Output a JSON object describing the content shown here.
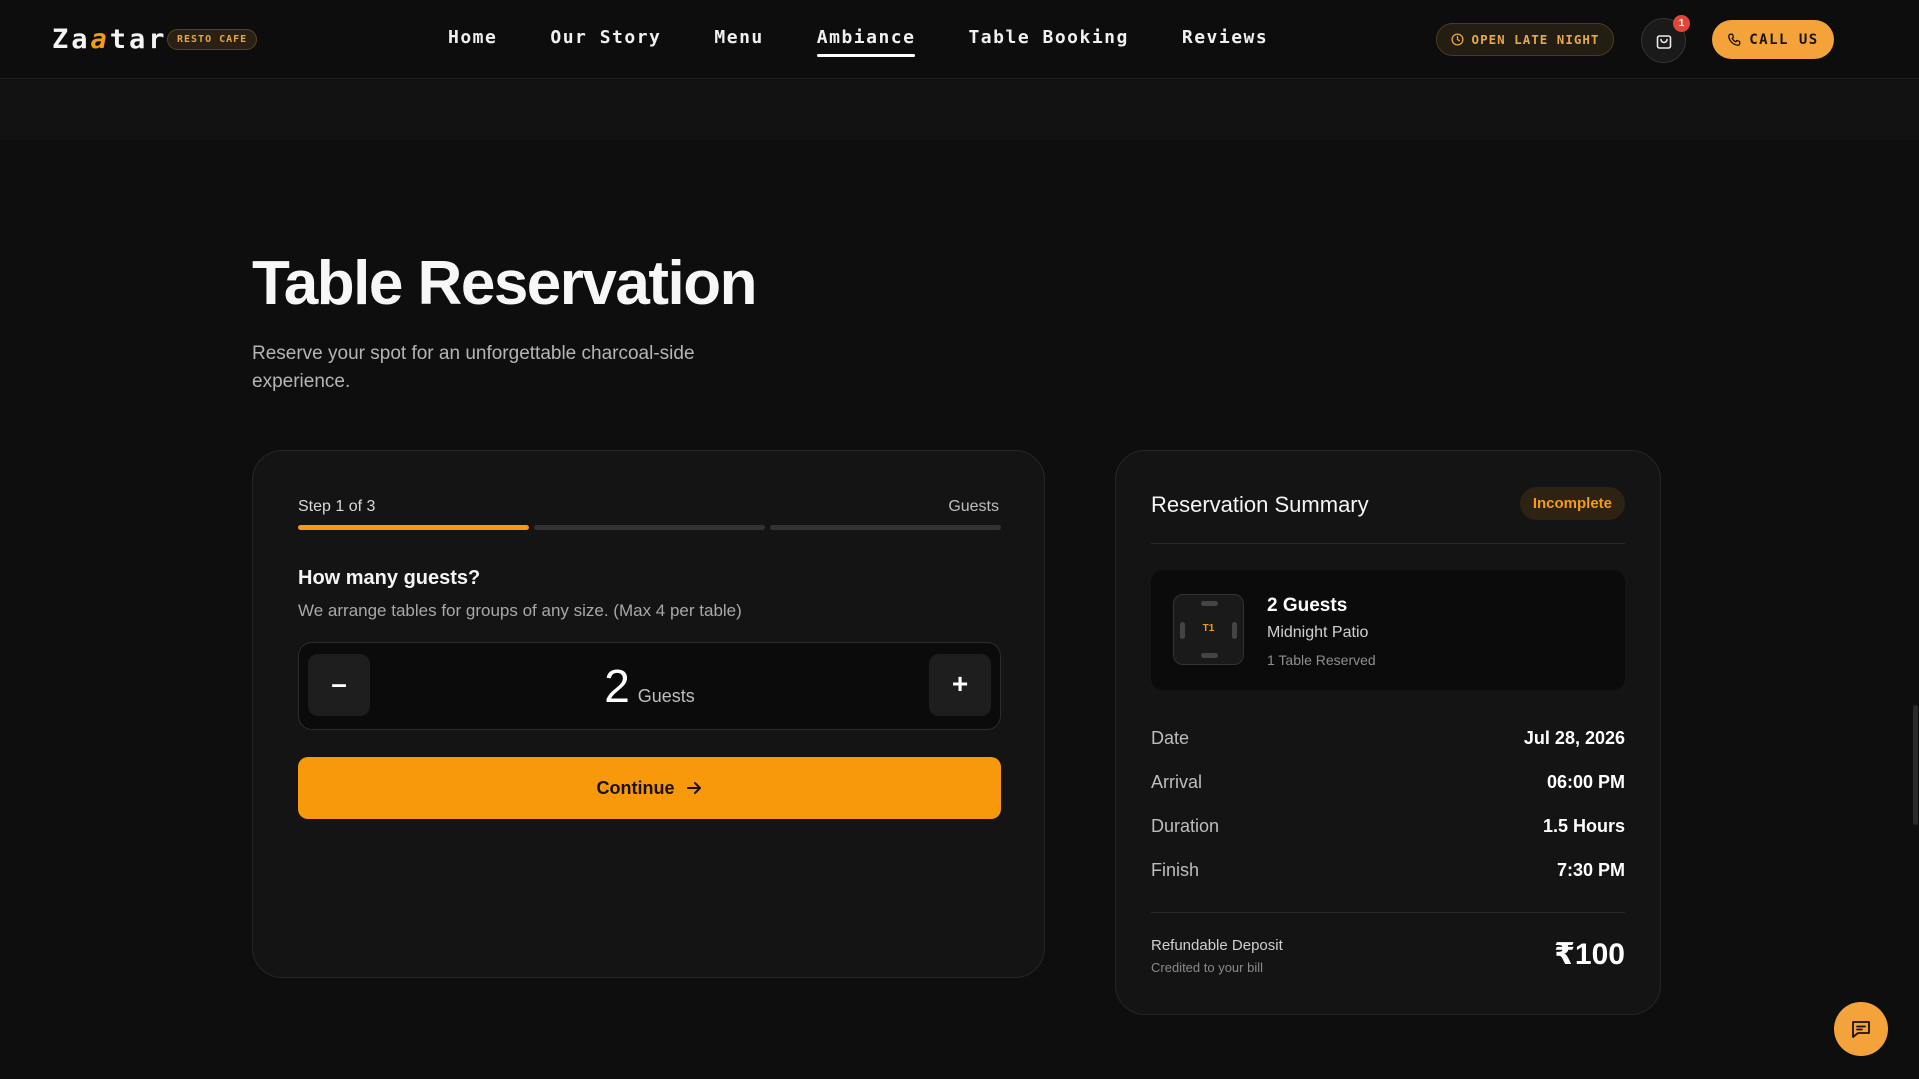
{
  "header": {
    "logo": {
      "pre": "Za",
      "accent": "a",
      "post": "tar",
      "badge": "RESTO CAFE"
    },
    "nav": [
      {
        "label": "Home"
      },
      {
        "label": "Our Story"
      },
      {
        "label": "Menu"
      },
      {
        "label": "Ambiance",
        "active": true
      },
      {
        "label": "Table Booking"
      },
      {
        "label": "Reviews"
      }
    ],
    "hours_badge": "OPEN LATE NIGHT",
    "cart_count": "1",
    "call_label": "CALL US",
    "accent_color": "#f39c12"
  },
  "hero": {
    "title": "Table Reservation",
    "subtitle": "Reserve your spot for an unforgettable charcoal-side experience."
  },
  "booking": {
    "step_label": "Step 1 of 3",
    "step_name": "Guests",
    "progress_steps_done": 1,
    "progress_steps_total": 3,
    "question": "How many guests?",
    "hint": "We arrange tables for groups of any size. (Max 4 per table)",
    "minus_label": "–",
    "plus_label": "+",
    "guest_count": "2",
    "guest_unit": "Guests",
    "continue_label": "Continue"
  },
  "summary": {
    "title": "Reservation Summary",
    "status": "Incomplete",
    "table": {
      "id": "T1",
      "guests": "2 Guests",
      "area": "Midnight Patio",
      "reserved": "1 Table Reserved"
    },
    "rows": [
      {
        "key": "Date",
        "value": "Jul 28, 2026"
      },
      {
        "key": "Arrival",
        "value": "06:00 PM"
      },
      {
        "key": "Duration",
        "value": "1.5 Hours"
      },
      {
        "key": "Finish",
        "value": "7:30 PM"
      }
    ],
    "deposit_label": "Refundable Deposit",
    "deposit_sub": "Credited to your bill",
    "deposit_amount": "₹100"
  }
}
